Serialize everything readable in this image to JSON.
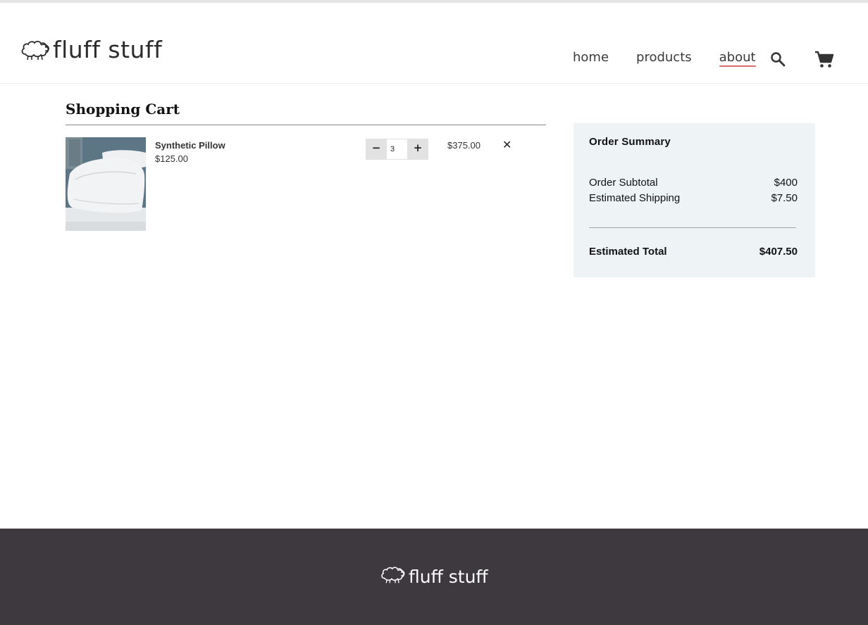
{
  "brand": {
    "name": "fluff stuff",
    "logo_icon": "sheep-icon"
  },
  "nav": {
    "items": [
      {
        "label": "home"
      },
      {
        "label": "products"
      },
      {
        "label": "about",
        "active": true
      }
    ],
    "search_icon": "search-icon",
    "cart_icon": "cart-icon"
  },
  "cart": {
    "title": "Shopping Cart",
    "items": [
      {
        "name": "Synthetic Pillow",
        "unit_price": "$125.00",
        "quantity": "3",
        "line_total": "$375.00",
        "minus_label": "−",
        "plus_label": "+",
        "remove_label": "✕"
      }
    ]
  },
  "summary": {
    "title": "Order Summary",
    "subtotal_label": "Order Subtotal",
    "subtotal_value": "$400",
    "shipping_label": "Estimated Shipping",
    "shipping_value": "$7.50",
    "total_label": "Estimated Total",
    "total_value": "$407.50"
  },
  "footer": {
    "brand": "fluff stuff"
  },
  "colors": {
    "active_underline": "#d86b6b",
    "summary_bg": "#eef3f6",
    "footer_bg": "#3d393e"
  }
}
